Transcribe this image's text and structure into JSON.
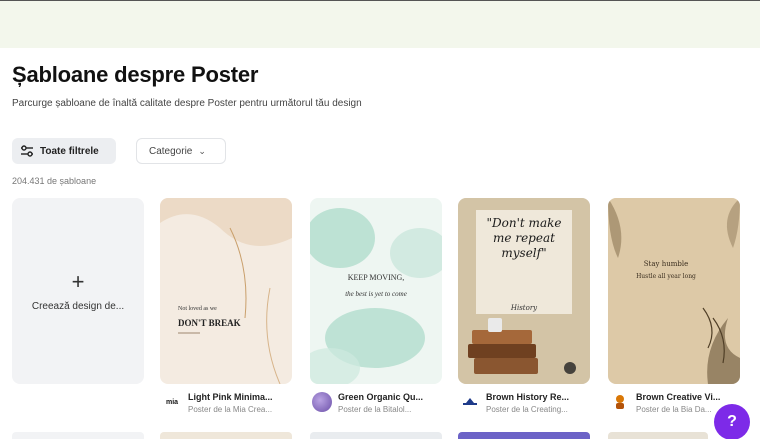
{
  "header": {
    "title": "Șabloane despre Poster",
    "subtitle": "Parcurge șabloane de înaltă calitate despre Poster pentru următorul tău design"
  },
  "filters": {
    "all_filters_label": "Toate filtrele",
    "category_label": "Categorie",
    "results_count": "204.431 de șabloane"
  },
  "create_card": {
    "plus": "+",
    "label": "Creează design de..."
  },
  "templates": [
    {
      "poster_text_top": "Not loved as we",
      "poster_text_main": "DON'T BREAK",
      "title": "Light Pink Minima...",
      "subtitle": "Poster de la Mia Crea...",
      "colors": {
        "bg": "#f5ebe0",
        "accent": "#e0c3a0"
      }
    },
    {
      "poster_text_top": "KEEP MOVING,",
      "poster_text_main": "the best is yet to come",
      "title": "Green Organic Qu...",
      "subtitle": "Poster de la Bitalol...",
      "colors": {
        "bg": "#eef6f1",
        "accent": "#9ed3c0"
      }
    },
    {
      "poster_text_top": "\"Don't make me repeat myself\"",
      "poster_text_main": "History",
      "title": "Brown History Re...",
      "subtitle": "Poster de la Creating...",
      "colors": {
        "bg": "#d9cbb3",
        "accent": "#7a5a3a"
      }
    },
    {
      "poster_text_top": "Stay humble",
      "poster_text_main": "Hustle all year long",
      "title": "Brown Creative Vi...",
      "subtitle": "Poster de la Bia Da...",
      "colors": {
        "bg": "#e8d7b8",
        "accent": "#6b5638"
      }
    }
  ],
  "help": {
    "label": "?"
  },
  "theme": {
    "accent": "#7d2ae8",
    "topbar": "#f3f7ec"
  }
}
